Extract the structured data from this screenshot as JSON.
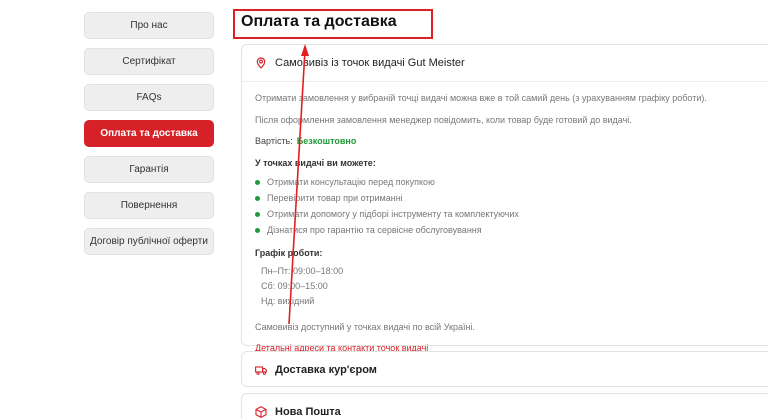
{
  "sidebar": {
    "items": [
      {
        "label": "Про нас"
      },
      {
        "label": "Сертифікат"
      },
      {
        "label": "FAQs"
      },
      {
        "label": "Оплата та доставка"
      },
      {
        "label": "Гарантія"
      },
      {
        "label": "Повернення"
      },
      {
        "label": "Договір публічної оферти"
      }
    ],
    "active_index": 3
  },
  "page": {
    "title": "Оплата та доставка"
  },
  "pickup": {
    "title": "Самовивіз із точок видачі Gut Meister",
    "p1": "Отримати замовлення у вибраній точці видачі можна вже в той самий день (з урахуванням графіку роботи).",
    "p2": "Після оформлення замовлення менеджер повідомить, коли товар буде готовий до видачі.",
    "price_label": "Вартість:",
    "price_value": "Безкоштовно",
    "can_title": "У точках видачі ви можете:",
    "can_items": [
      "Отримати консультацію перед покупкою",
      "Перевірити товар при отриманні",
      "Отримати допомогу у підборі інструменту та комплектуючих",
      "Дізнатися про гарантію та сервісне обслуговування"
    ],
    "schedule_title": "Графік роботи:",
    "schedule": [
      "Пн–Пт: 09:00–18:00",
      "Сб: 09:00–15:00",
      "Нд: вихідний"
    ],
    "availability": "Самовивіз доступний у точках видачі по всій Україні.",
    "link": "Детальні адреси та контакти точок видачі"
  },
  "courier": {
    "title": "Доставка кур'єром"
  },
  "novaposhta": {
    "title": "Нова Пошта"
  },
  "colors": {
    "accent": "#d62128",
    "green": "#1f9a3a",
    "annotation": "#e02020"
  },
  "icons": {
    "pickup": "location-pin-icon",
    "courier": "truck-icon",
    "novaposhta": "box-icon"
  }
}
